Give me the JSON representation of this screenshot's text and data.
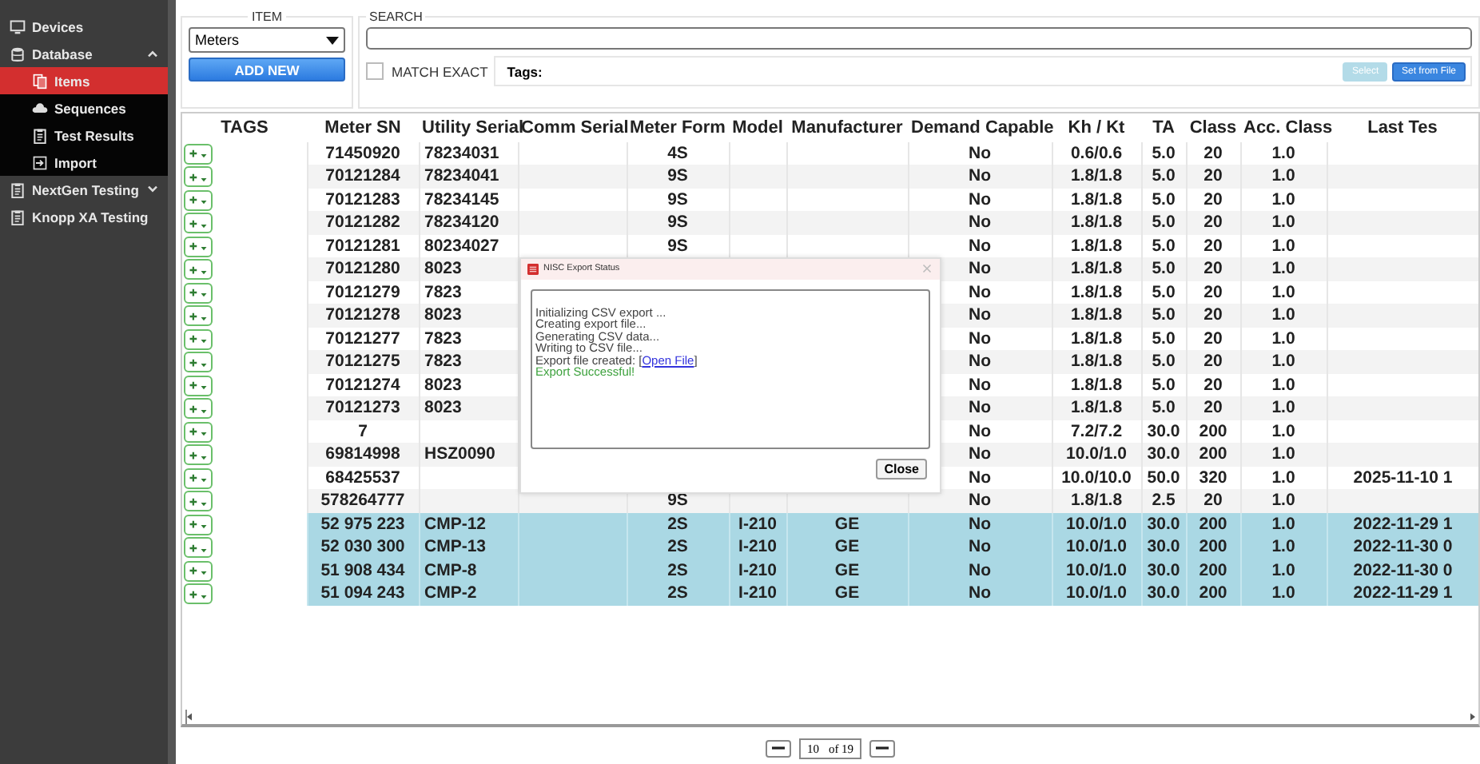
{
  "sidebar": {
    "items": [
      {
        "label": "Devices",
        "selected": false
      },
      {
        "label": "Database",
        "selected": false,
        "expanded": true,
        "children": [
          {
            "label": "Items",
            "selected": true
          },
          {
            "label": "Sequences",
            "selected": false
          },
          {
            "label": "Test Results",
            "selected": false
          },
          {
            "label": "Import",
            "selected": false
          }
        ]
      },
      {
        "label": "NextGen Testing",
        "selected": false,
        "expanded": false
      },
      {
        "label": "Knopp XA Testing",
        "selected": false
      }
    ]
  },
  "item_panel": {
    "legend": "ITEM",
    "select_value": "Meters",
    "add_button": "ADD NEW"
  },
  "search_panel": {
    "legend": "SEARCH",
    "match_exact": {
      "label": "MATCH EXACT",
      "checked": false
    },
    "tags_label": "Tags:",
    "select_button": {
      "label": "Select",
      "disabled": true
    },
    "set_from_file_button": "Set from File"
  },
  "table": {
    "columns": [
      "TAGS",
      "Meter SN",
      "Utility Serial",
      "Comm Serial",
      "Meter Form",
      "Model",
      "Manufacturer",
      "Demand Capable",
      "Kh / Kt",
      "TA",
      "Class",
      "Acc. Class",
      "Last Tes"
    ],
    "rows": [
      {
        "selected": false,
        "cells": [
          "",
          "71450920",
          "78234031",
          null,
          "4S",
          null,
          null,
          "No",
          "0.6/0.6",
          "5.0",
          "20",
          "1.0",
          null
        ]
      },
      {
        "selected": false,
        "cells": [
          "",
          "70121284",
          "78234041",
          null,
          "9S",
          null,
          null,
          "No",
          "1.8/1.8",
          "5.0",
          "20",
          "1.0",
          null
        ]
      },
      {
        "selected": false,
        "cells": [
          "",
          "70121283",
          "78234145",
          null,
          "9S",
          null,
          null,
          "No",
          "1.8/1.8",
          "5.0",
          "20",
          "1.0",
          null
        ]
      },
      {
        "selected": false,
        "cells": [
          "",
          "70121282",
          "78234120",
          null,
          "9S",
          null,
          null,
          "No",
          "1.8/1.8",
          "5.0",
          "20",
          "1.0",
          null
        ]
      },
      {
        "selected": false,
        "cells": [
          "",
          "70121281",
          "80234027",
          null,
          "9S",
          null,
          null,
          "No",
          "1.8/1.8",
          "5.0",
          "20",
          "1.0",
          null
        ]
      },
      {
        "selected": false,
        "cells": [
          "",
          "70121280",
          "8023",
          null,
          null,
          null,
          null,
          "No",
          "1.8/1.8",
          "5.0",
          "20",
          "1.0",
          null
        ]
      },
      {
        "selected": false,
        "cells": [
          "",
          "70121279",
          "7823",
          null,
          null,
          null,
          null,
          "No",
          "1.8/1.8",
          "5.0",
          "20",
          "1.0",
          null
        ]
      },
      {
        "selected": false,
        "cells": [
          "",
          "70121278",
          "8023",
          null,
          null,
          null,
          null,
          "No",
          "1.8/1.8",
          "5.0",
          "20",
          "1.0",
          null
        ]
      },
      {
        "selected": false,
        "cells": [
          "",
          "70121277",
          "7823",
          null,
          null,
          null,
          null,
          "No",
          "1.8/1.8",
          "5.0",
          "20",
          "1.0",
          null
        ]
      },
      {
        "selected": false,
        "cells": [
          "",
          "70121275",
          "7823",
          null,
          null,
          null,
          null,
          "No",
          "1.8/1.8",
          "5.0",
          "20",
          "1.0",
          null
        ]
      },
      {
        "selected": false,
        "cells": [
          "",
          "70121274",
          "8023",
          null,
          null,
          null,
          null,
          "No",
          "1.8/1.8",
          "5.0",
          "20",
          "1.0",
          null
        ]
      },
      {
        "selected": false,
        "cells": [
          "",
          "70121273",
          "8023",
          null,
          null,
          null,
          null,
          "No",
          "1.8/1.8",
          "5.0",
          "20",
          "1.0",
          null
        ]
      },
      {
        "selected": false,
        "cells": [
          "",
          "7",
          null,
          null,
          null,
          null,
          null,
          "No",
          "7.2/7.2",
          "30.0",
          "200",
          "1.0",
          null
        ]
      },
      {
        "selected": false,
        "cells": [
          "",
          "69814998",
          "HSZ0090",
          null,
          null,
          null,
          null,
          "No",
          "10.0/1.0",
          "30.0",
          "200",
          "1.0",
          null
        ]
      },
      {
        "selected": false,
        "cells": [
          "",
          "68425537",
          null,
          null,
          null,
          null,
          null,
          "No",
          "10.0/10.0",
          "50.0",
          "320",
          "1.0",
          "2025-11-10 1"
        ]
      },
      {
        "selected": false,
        "cells": [
          "",
          "578264777",
          null,
          null,
          "9S",
          null,
          null,
          "No",
          "1.8/1.8",
          "2.5",
          "20",
          "1.0",
          null
        ]
      },
      {
        "selected": true,
        "cells": [
          "",
          "52 975 223",
          "CMP-12",
          null,
          "2S",
          "I-210",
          "GE",
          "No",
          "10.0/1.0",
          "30.0",
          "200",
          "1.0",
          "2022-11-29 1"
        ]
      },
      {
        "selected": true,
        "cells": [
          "",
          "52 030 300",
          "CMP-13",
          null,
          "2S",
          "I-210",
          "GE",
          "No",
          "10.0/1.0",
          "30.0",
          "200",
          "1.0",
          "2022-11-30 0"
        ]
      },
      {
        "selected": true,
        "cells": [
          "",
          "51 908 434",
          "CMP-8",
          null,
          "2S",
          "I-210",
          "GE",
          "No",
          "10.0/1.0",
          "30.0",
          "200",
          "1.0",
          "2022-11-30 0"
        ]
      },
      {
        "selected": true,
        "cells": [
          "",
          "51 094 243",
          "CMP-2",
          null,
          "2S",
          "I-210",
          "GE",
          "No",
          "10.0/1.0",
          "30.0",
          "200",
          "1.0",
          "2022-11-29 1"
        ]
      }
    ]
  },
  "dialog": {
    "title": "NISC Export Status",
    "lines": [
      {
        "kind": "plain",
        "text": "Initializing CSV export ..."
      },
      {
        "kind": "plain",
        "text": "Creating export file..."
      },
      {
        "kind": "plain",
        "text": "Generating CSV data..."
      },
      {
        "kind": "plain",
        "text": "Writing to CSV file..."
      },
      {
        "kind": "link",
        "text": "Export file created: [",
        "link": "Open File",
        "after": "]"
      },
      {
        "kind": "success",
        "text": "Export Successful!"
      }
    ],
    "close_button": "Close"
  },
  "pagination": {
    "page": "10",
    "total": "of 19"
  }
}
